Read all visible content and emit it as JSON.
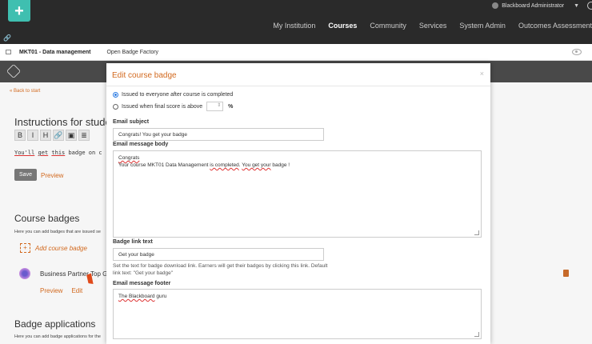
{
  "header": {
    "admin_name": "Blackboard Administrator",
    "nav": [
      "My Institution",
      "Courses",
      "Community",
      "Services",
      "System Admin",
      "Outcomes Assessment"
    ],
    "active_nav": "Courses"
  },
  "breadcrumb": {
    "course": "MKT01 - Data management",
    "page": "Open Badge Factory"
  },
  "background": {
    "back_link": "« Back to start",
    "instructions_heading": "Instructions for student",
    "editor_buttons": [
      "B",
      "I",
      "H",
      "🔗",
      "▣",
      "≣"
    ],
    "editor_text_words": [
      "You'll",
      "get",
      "this",
      "badge on c"
    ],
    "save_label": "Save",
    "preview_label": "Preview",
    "course_badges_heading": "Course badges",
    "course_badges_desc": "Here you can add badges that are issued se",
    "add_badge_label": "Add course badge",
    "badge_name": "Business Partner Top Guru",
    "badge_preview": "Preview",
    "badge_edit": "Edit",
    "badge_apps_heading": "Badge applications",
    "badge_apps_desc": "Here you can add badge applications for the"
  },
  "modal": {
    "title": "Edit course badge",
    "close": "×",
    "option_completed": "Issued to everyone after course is completed",
    "option_score": "Issued when final score is above",
    "percent_sign": "%",
    "email_subject_label": "Email subject",
    "email_subject_value": "Congrats!  You get your badge",
    "email_body_label": "Email message body",
    "email_body_line1": "Congrats",
    "email_body_line2_parts": [
      "Your course MKT01 Data Management ",
      "is completed",
      ". ",
      "You get your",
      " badge !"
    ],
    "badge_link_label": "Badge link text",
    "badge_link_value": "Get your badge",
    "badge_link_help": "Set the text for badge download link. Earners will get their badges by clicking this link. Default link text: \"Get your badge\"",
    "footer_label": "Email message footer",
    "footer_value_parts": [
      "The Blackboard",
      " guru"
    ]
  }
}
